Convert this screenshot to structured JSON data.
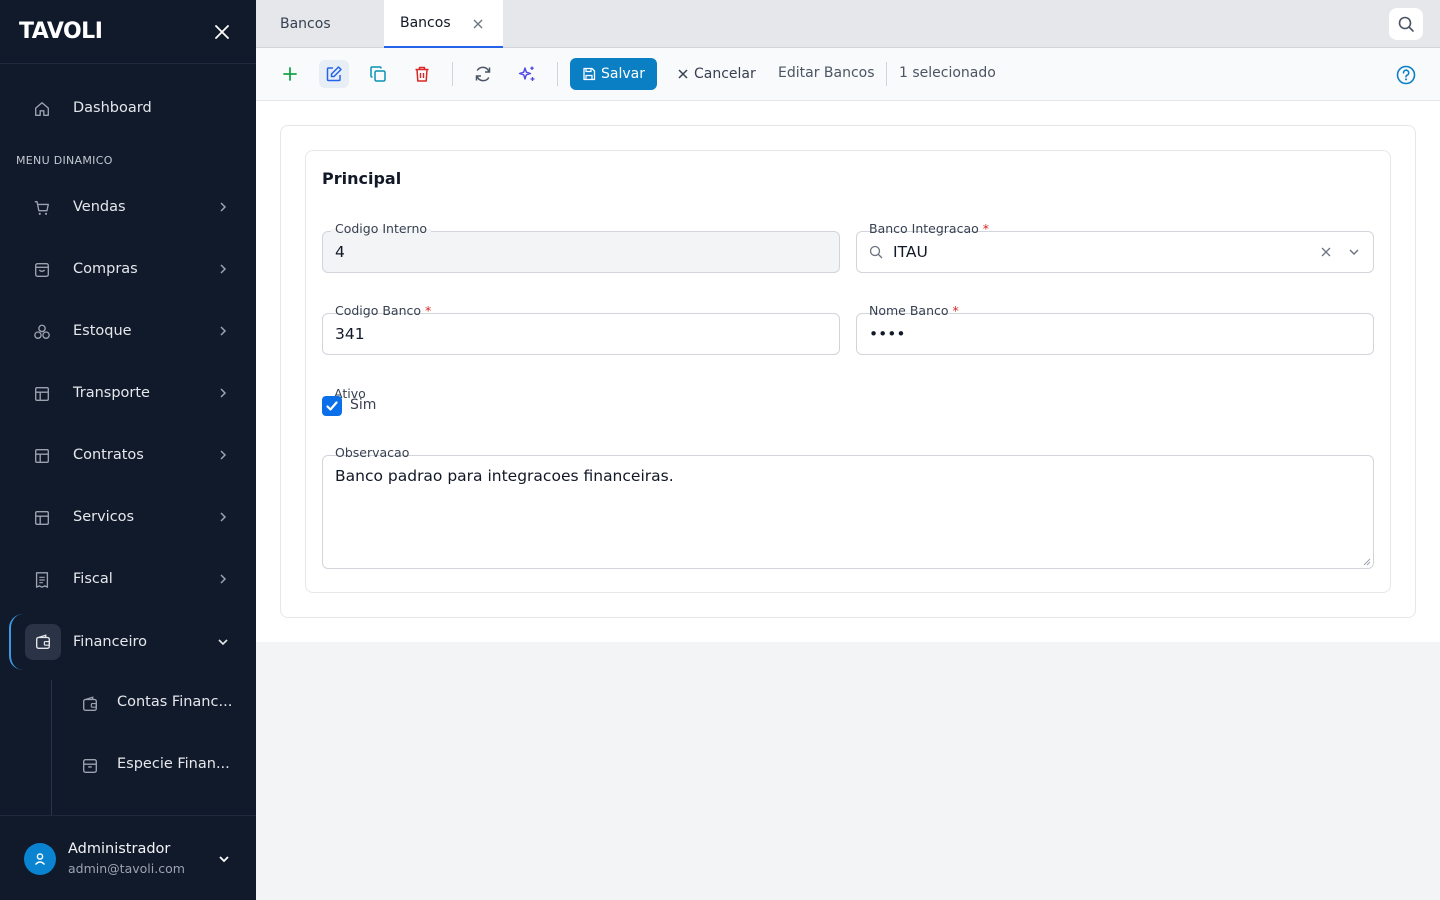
{
  "sidebar": {
    "logo": "TAVOLI",
    "dashboard_label": "Dashboard",
    "section_title": "MENU DINAMICO",
    "items": [
      {
        "label": "Vendas",
        "icon": "cart-icon"
      },
      {
        "label": "Compras",
        "icon": "shopping-bag-icon"
      },
      {
        "label": "Estoque",
        "icon": "boxes-icon"
      },
      {
        "label": "Transporte",
        "icon": "layout-icon"
      },
      {
        "label": "Contratos",
        "icon": "layout-icon"
      },
      {
        "label": "Servicos",
        "icon": "layout-icon"
      },
      {
        "label": "Fiscal",
        "icon": "receipt-icon"
      },
      {
        "label": "Financeiro",
        "icon": "wallet-icon"
      }
    ],
    "sub_items": [
      {
        "label": "Contas Financ...",
        "icon": "wallet-icon"
      },
      {
        "label": "Especie Finan...",
        "icon": "archive-icon"
      }
    ],
    "user": {
      "name": "Administrador",
      "email": "admin@tavoli.com"
    }
  },
  "tabs": [
    {
      "label": "Bancos"
    },
    {
      "label": "Bancos",
      "active": true
    }
  ],
  "toolbar": {
    "save_label": "Salvar",
    "cancel_label": "Cancelar",
    "edit_title": "Editar Bancos",
    "selection_count": "1 selecionado"
  },
  "form": {
    "section_title": "Principal",
    "codigo_interno": {
      "label": "Codigo Interno",
      "value": "4"
    },
    "banco_integracao": {
      "label": "Banco Integracao",
      "required_mark": "*",
      "value": "ITAU"
    },
    "codigo_banco": {
      "label": "Codigo Banco",
      "required_mark": "*",
      "value": "341"
    },
    "nome_banco": {
      "label": "Nome Banco",
      "required_mark": "*",
      "value": "••••"
    },
    "ativo": {
      "label": "Ativo",
      "option_label": "Sim",
      "checked": true
    },
    "observacao": {
      "label": "Observacao",
      "value": "Banco padrao para integracoes financeiras."
    }
  },
  "colors": {
    "sidebar_bg": "#111a2b",
    "primary": "#0b7fc4",
    "active_tab_underline": "#2563eb",
    "required": "#dc2626",
    "add_icon": "#16a34a",
    "delete_icon": "#dc2626"
  }
}
